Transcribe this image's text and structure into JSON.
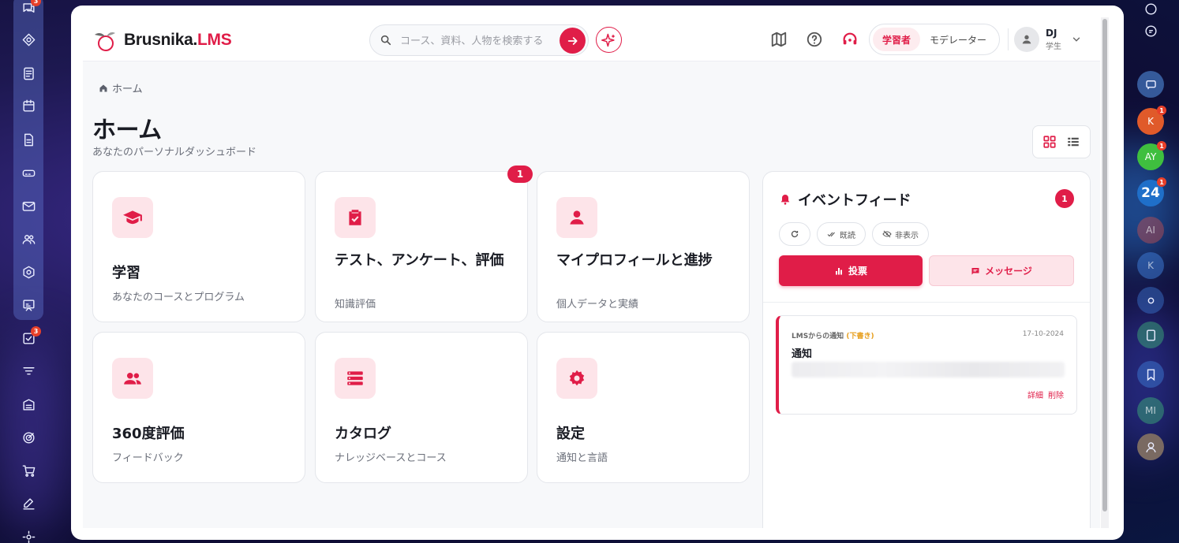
{
  "app": {
    "brand_part1": "Brusnika.",
    "brand_part2": "LMS",
    "accent": "#e01d48"
  },
  "search": {
    "placeholder": "コース、資料、人物を検索する"
  },
  "roles": {
    "learner": "学習者",
    "moderator": "モデレーター"
  },
  "user": {
    "initials": "DJ",
    "role": "学生"
  },
  "left_dock": {
    "badges": {
      "chat": "3",
      "tasks": "3"
    }
  },
  "right_dock": {
    "items": [
      {
        "label": "K",
        "badge": "1"
      },
      {
        "label": "AY",
        "badge": "1"
      },
      {
        "label": "24",
        "badge": "1"
      },
      {
        "label": "AI"
      },
      {
        "label": "K"
      },
      {
        "label": "MI"
      }
    ]
  },
  "breadcrumb": {
    "home": "ホーム"
  },
  "page": {
    "title": "ホーム",
    "subtitle": "あなたのパーソナルダッシュボード"
  },
  "cards": [
    {
      "title": "学習",
      "subtitle": "あなたのコースとプログラム"
    },
    {
      "title": "テスト、アンケート、評価",
      "subtitle": "知識評価",
      "badge": "1"
    },
    {
      "title": "マイプロフィールと進捗",
      "subtitle": "個人データと実績"
    },
    {
      "title": "360度評価",
      "subtitle": "フィードバック"
    },
    {
      "title": "カタログ",
      "subtitle": "ナレッジベースとコース"
    },
    {
      "title": "設定",
      "subtitle": "通知と言語"
    }
  ],
  "feed": {
    "title": "イベントフィード",
    "count": "1",
    "read_label": "既読",
    "hide_label": "非表示",
    "vote_label": "投票",
    "message_label": "メッセージ",
    "notice": {
      "source": "LMSからの通知",
      "status": "(下書き)",
      "date": "17-10-2024",
      "title": "通知",
      "details_label": "詳細",
      "delete_label": "削除"
    }
  }
}
